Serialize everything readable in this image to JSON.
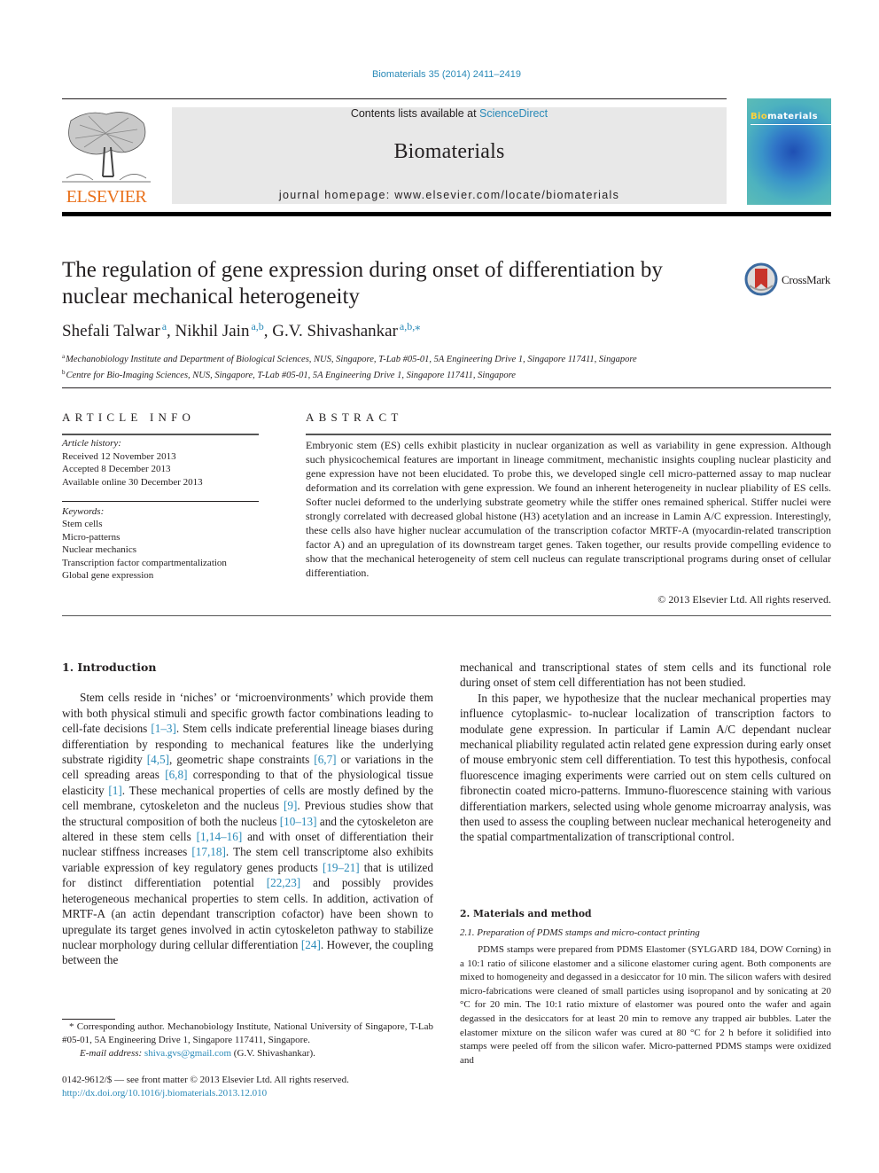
{
  "header": {
    "journal_ref": "Biomaterials 35 (2014) 2411–2419",
    "contents_prefix": "Contents lists available at ",
    "contents_link": "ScienceDirect",
    "journal_name": "Biomaterials",
    "homepage": "journal homepage: www.elsevier.com/locate/biomaterials",
    "publisher_wordmark": "ELSEVIER",
    "cover_title_initial": "Bio",
    "cover_title_rest": "materials",
    "crossmark_label": "CrossMark",
    "colors": {
      "link": "#2a8ab8",
      "elsevier_orange": "#e9711c",
      "banner_bg": "#e8e8e8"
    }
  },
  "article": {
    "title": "The regulation of gene expression during onset of differentiation by nuclear mechanical heterogeneity",
    "authors": [
      {
        "name": "Shefali Talwar",
        "sup": "a",
        "sep": ", "
      },
      {
        "name": "Nikhil Jain",
        "sup": "a,b",
        "sep": ", "
      },
      {
        "name": "G.V. Shivashankar",
        "sup": "a,b,⁎",
        "sep": ""
      }
    ],
    "affiliations": [
      {
        "key": "a",
        "text": "Mechanobiology Institute and Department of Biological Sciences, NUS, Singapore, T-Lab #05-01, 5A Engineering Drive 1, Singapore 117411, Singapore"
      },
      {
        "key": "b",
        "text": "Centre for Bio-Imaging Sciences, NUS, Singapore, T-Lab #05-01, 5A Engineering Drive 1, Singapore 117411, Singapore"
      }
    ]
  },
  "article_info": {
    "heading": "ARTICLE INFO",
    "history_label": "Article history:",
    "history": [
      "Received 12 November 2013",
      "Accepted 8 December 2013",
      "Available online 30 December 2013"
    ],
    "keywords_label": "Keywords:",
    "keywords": [
      "Stem cells",
      "Micro-patterns",
      "Nuclear mechanics",
      "Transcription factor compartmentalization",
      "Global gene expression"
    ]
  },
  "abstract": {
    "heading": "ABSTRACT",
    "text": "Embryonic stem (ES) cells exhibit plasticity in nuclear organization as well as variability in gene expression. Although such physicochemical features are important in lineage commitment, mechanistic insights coupling nuclear plasticity and gene expression have not been elucidated. To probe this, we developed single cell micro-patterned assay to map nuclear deformation and its correlation with gene expression. We found an inherent heterogeneity in nuclear pliability of ES cells. Softer nuclei deformed to the underlying substrate geometry while the stiffer ones remained spherical. Stiffer nuclei were strongly correlated with decreased global histone (H3) acetylation and an increase in Lamin A/C expression. Interestingly, these cells also have higher nuclear accumulation of the transcription cofactor MRTF-A (myocardin-related transcription factor A) and an upregulation of its downstream target genes. Taken together, our results provide compelling evidence to show that the mechanical heterogeneity of stem cell nucleus can regulate transcriptional programs during onset of cellular differentiation.",
    "copyright": "© 2013 Elsevier Ltd. All rights reserved."
  },
  "body": {
    "intro_heading": "1.  Introduction",
    "intro_p1": [
      {
        "t": "Stem cells reside in ‘niches’ or ‘microenvironments’ which provide them with both physical stimuli and specific growth factor combinations leading to cell-fate decisions "
      },
      {
        "r": "[1–3]"
      },
      {
        "t": ". Stem cells indicate preferential lineage biases during differentiation by responding to mechanical features like the underlying substrate rigidity "
      },
      {
        "r": "[4,5]"
      },
      {
        "t": ", geometric shape constraints "
      },
      {
        "r": "[6,7]"
      },
      {
        "t": " or variations in the cell spreading areas "
      },
      {
        "r": "[6,8]"
      },
      {
        "t": " corresponding to that of the physiological tissue elasticity "
      },
      {
        "r": "[1]"
      },
      {
        "t": ". These mechanical properties of cells are mostly defined by the cell membrane, cytoskeleton and the nucleus "
      },
      {
        "r": "[9]"
      },
      {
        "t": ". Previous studies show that the structural composition of both the nucleus "
      },
      {
        "r": "[10–13]"
      },
      {
        "t": " and the cytoskeleton are altered in these stem cells "
      },
      {
        "r": "[1,14–16]"
      },
      {
        "t": " and with onset of differentiation their nuclear stiffness increases "
      },
      {
        "r": "[17,18]"
      },
      {
        "t": ". The stem cell transcriptome also exhibits variable expression of key regulatory genes products "
      },
      {
        "r": "[19–21]"
      },
      {
        "t": " that is utilized for distinct differentiation potential "
      },
      {
        "r": "[22,23]"
      },
      {
        "t": " and possibly provides heterogeneous mechanical properties to stem cells. In addition, activation of MRTF-A (an actin dependant transcription cofactor) have been shown to upregulate its target genes involved in actin cytoskeleton pathway to stabilize nuclear morphology during cellular differentiation "
      },
      {
        "r": "[24]"
      },
      {
        "t": ". However, the coupling between the"
      }
    ],
    "right_p1": "mechanical and transcriptional states of stem cells and its functional role during onset of stem cell differentiation has not been studied.",
    "right_p2": "In this paper, we hypothesize that the nuclear mechanical properties may influence cytoplasmic- to-nuclear localization of transcription factors to modulate gene expression. In particular if Lamin A/C dependant nuclear mechanical pliability regulated actin related gene expression during early onset of mouse embryonic stem cell differentiation. To test this hypothesis, confocal fluorescence imaging experiments were carried out on stem cells cultured on fibronectin coated micro-patterns. Immuno-fluorescence staining with various differentiation markers, selected using whole genome microarray analysis, was then used to assess the coupling between nuclear mechanical heterogeneity and the spatial compartmentalization of transcriptional control.",
    "methods_heading": "2.  Materials and method",
    "methods_subheading": "2.1.  Preparation of PDMS stamps and micro-contact printing",
    "methods_text": "PDMS stamps were prepared from PDMS Elastomer (SYLGARD 184, DOW Corning) in a 10:1 ratio of silicone elastomer and a silicone elastomer curing agent. Both components are mixed to homogeneity and degassed in a desiccator for 10 min. The silicon wafers with desired micro-fabrications were cleaned of small particles using isopropanol and by sonicating at 20 °C for 20 min. The 10:1 ratio mixture of elastomer was poured onto the wafer and again degassed in the desiccators for at least 20 min to remove any trapped air bubbles. Later the elastomer mixture on the silicon wafer was cured at 80 °C for 2 h before it solidified into stamps were peeled off from the silicon wafer. Micro-patterned PDMS stamps were oxidized and"
  },
  "footnotes": {
    "corresponding": "* Corresponding author. Mechanobiology Institute, National University of Singapore, T-Lab #05-01, 5A Engineering Drive 1, Singapore 117411, Singapore.",
    "email_label": "E-mail address: ",
    "email": "shiva.gvs@gmail.com",
    "email_suffix": " (G.V. Shivashankar).",
    "issn_line": "0142-9612/$ — see front matter © 2013 Elsevier Ltd. All rights reserved.",
    "doi": "http://dx.doi.org/10.1016/j.biomaterials.2013.12.010"
  }
}
